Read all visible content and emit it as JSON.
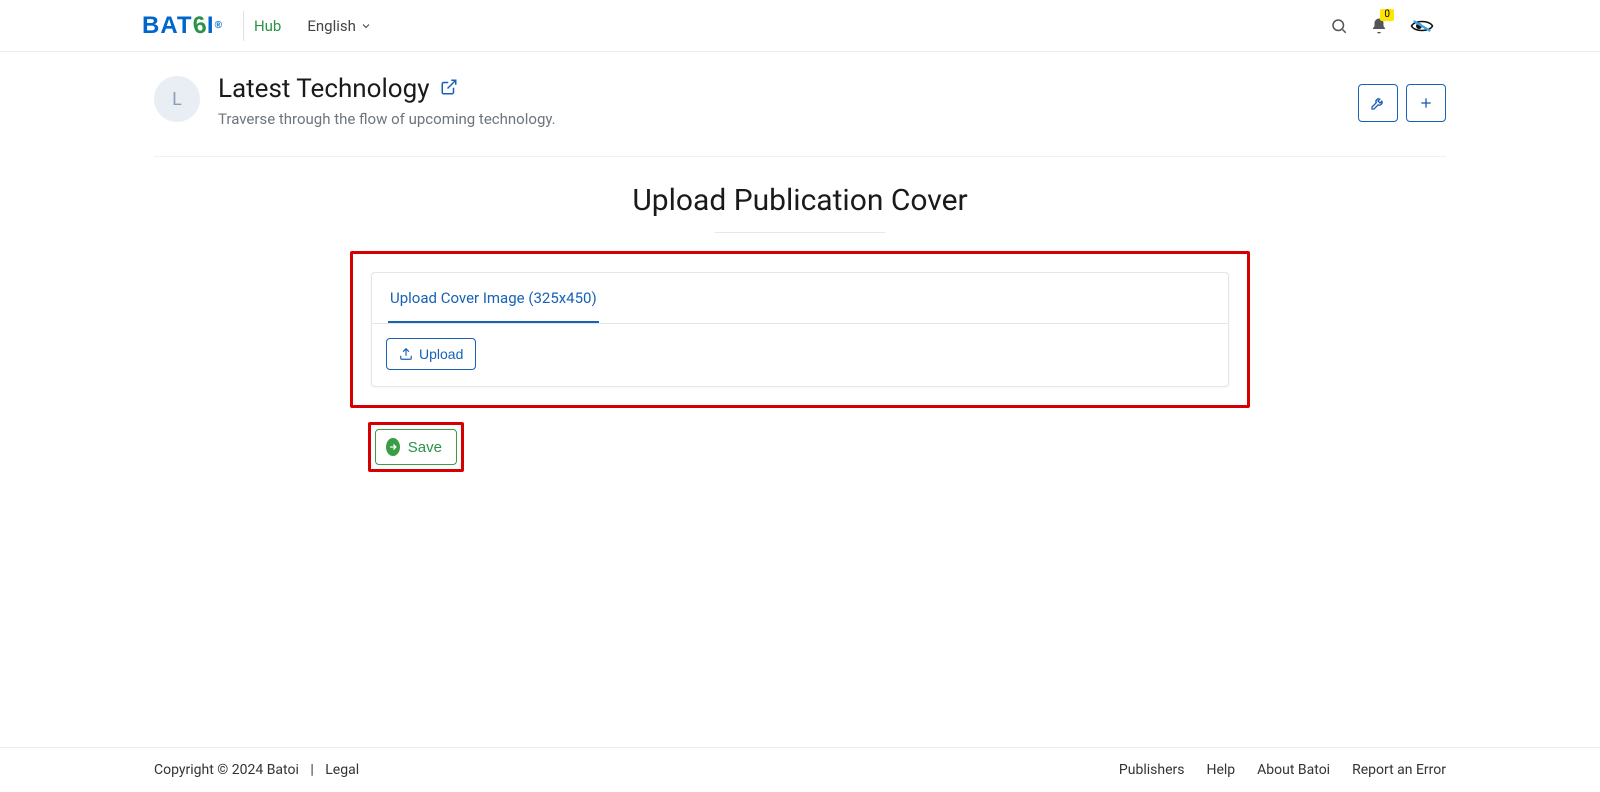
{
  "nav": {
    "brand_parts": {
      "pre": "BAT",
      "swirl": "6",
      "post": "I",
      "reg": "®"
    },
    "hub_label": "Hub",
    "language_label": "English",
    "bell_badge": "0"
  },
  "header": {
    "avatar_initial": "L",
    "title": "Latest Technology",
    "subtitle": "Traverse through the flow of upcoming technology."
  },
  "main": {
    "section_title": "Upload Publication Cover",
    "tab_label": "Upload Cover Image (325x450)",
    "upload_button": "Upload",
    "save_button": "Save"
  },
  "footer": {
    "copyright": "Copyright © 2024 Batoi",
    "legal": "Legal",
    "links": [
      "Publishers",
      "Help",
      "About Batoi",
      "Report an Error"
    ]
  }
}
